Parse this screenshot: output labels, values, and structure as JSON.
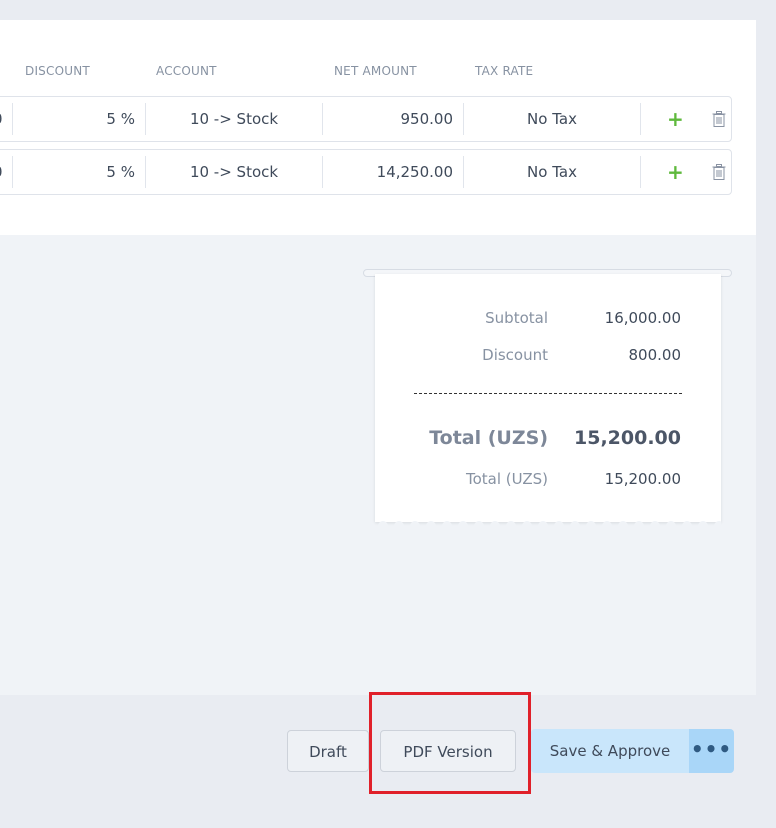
{
  "table": {
    "headers": {
      "discount": "DISCOUNT",
      "account": "ACCOUNT",
      "net_amount": "NET AMOUNT",
      "tax_rate": "TAX RATE"
    },
    "rows": [
      {
        "qty_tail": "0",
        "discount": "5 %",
        "account": "10 -> Stock",
        "net_amount": "950.00",
        "tax_rate": "No Tax"
      },
      {
        "qty_tail": "0",
        "discount": "5 %",
        "account": "10 -> Stock",
        "net_amount": "14,250.00",
        "tax_rate": "No Tax"
      }
    ],
    "add_icon": "plus-icon",
    "delete_icon": "trash-icon"
  },
  "summary": {
    "subtotal_label": "Subtotal",
    "subtotal_value": "16,000.00",
    "discount_label": "Discount",
    "discount_value": "800.00",
    "total_label": "Total (UZS)",
    "total_value": "15,200.00",
    "total2_label": "Total (UZS)",
    "total2_value": "15,200.00"
  },
  "actions": {
    "draft_label": "Draft",
    "pdf_label": "PDF Version",
    "save_label": "Save & Approve",
    "more_label": "•••"
  },
  "colors": {
    "accent_button": "#c9e6fb",
    "add_green": "#5fb93d",
    "highlight_red": "#e0202a"
  }
}
